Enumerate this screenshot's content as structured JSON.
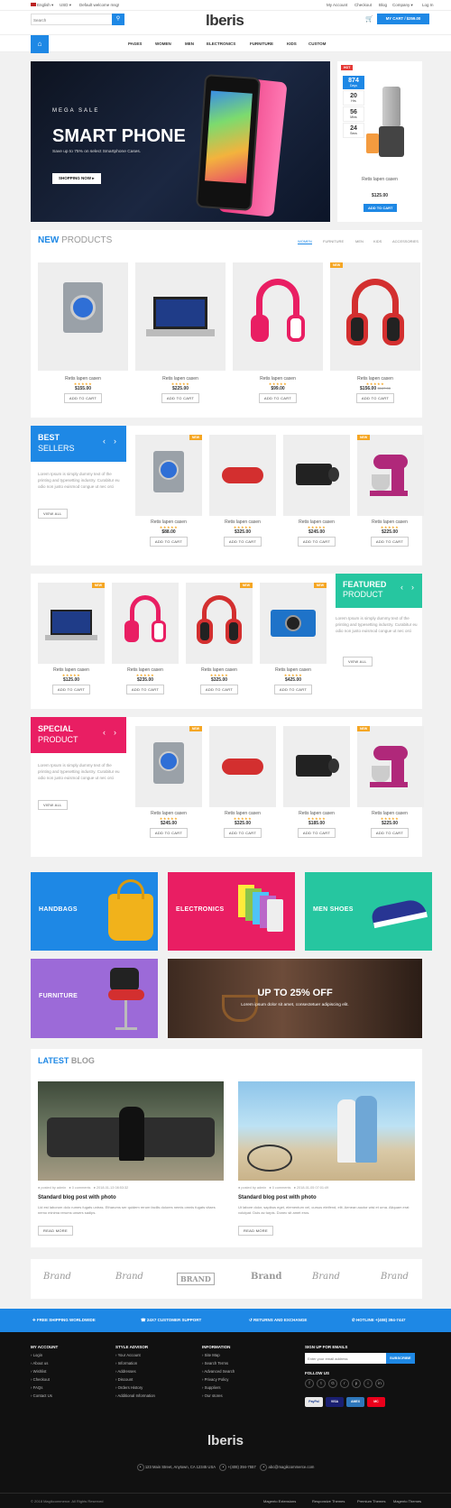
{
  "topbar": {
    "language": "English",
    "currency": "USD",
    "welcome": "Default welcome msg!",
    "links": [
      "My Account",
      "Checkout",
      "Blog",
      "Company",
      "Log In"
    ]
  },
  "header": {
    "search_placeholder": "Search",
    "logo": "lberis",
    "cart": "MY CART / $259.00"
  },
  "nav": {
    "items": [
      "PAGES",
      "WOMEN",
      "MEN",
      "ELECTRONICS",
      "FURNITURE",
      "KIDS",
      "CUSTOM"
    ]
  },
  "hero": {
    "kicker": "MEGA SALE",
    "title": "SMART PHONE",
    "subtitle": "Save up to 75% on select Smartphone Cases.",
    "cta": "SHOPPING NOW"
  },
  "deal": {
    "badge": "HOT",
    "countdown": [
      {
        "value": "874",
        "unit": "Days"
      },
      {
        "value": "20",
        "unit": "Hrs"
      },
      {
        "value": "56",
        "unit": "Mins"
      },
      {
        "value": "24",
        "unit": "Secs"
      }
    ],
    "name": "Retis lapen casen",
    "price": "$125.00",
    "cta": "ADD TO CART"
  },
  "new_products": {
    "title_a": "NEW",
    "title_b": "PRODUCTS",
    "tabs": [
      "WOMEN",
      "FURNITURE",
      "MEN",
      "KIDS",
      "ACCESSORIES"
    ],
    "items": [
      {
        "name": "Retis lapen casen",
        "price": "$155.00",
        "old": "",
        "cta": "ADD TO CART"
      },
      {
        "name": "Retis lapen casen",
        "price": "$225.00",
        "old": "",
        "cta": "ADD TO CART"
      },
      {
        "name": "Retis lapen casen",
        "price": "$99.00",
        "old": "",
        "cta": "ADD TO CART"
      },
      {
        "name": "Retis lapen casen",
        "price": "$156.00",
        "old": "$167.00",
        "cta": "ADD TO CART",
        "badge": "NEW"
      }
    ]
  },
  "best": {
    "title_a": "BEST",
    "title_b": "SELLERS",
    "text": "Lorem Ipsum is simply dummy text of the printing and typesetting industry. Curabitur eu odio non justo euismod congue ut nec orci",
    "cta": "VIEW ALL",
    "items": [
      {
        "name": "Retis lapen casen",
        "price": "$88.00",
        "cta": "ADD TO CART",
        "badge": "NEW"
      },
      {
        "name": "Retis lapen casen",
        "price": "$325.00",
        "cta": "ADD TO CART"
      },
      {
        "name": "Retis lapen casen",
        "price": "$245.00",
        "cta": "ADD TO CART"
      },
      {
        "name": "Retis lapen casen",
        "price": "$225.00",
        "cta": "ADD TO CART",
        "badge": "NEW"
      }
    ]
  },
  "featured": {
    "title_a": "FEATURED",
    "title_b": "PRODUCT",
    "text": "Lorem Ipsum is simply dummy text of the printing and typesetting industry. Curabitur eu odio non justo euismod congue ut nec orci",
    "cta": "VIEW ALL",
    "items": [
      {
        "name": "Retis lapen casen",
        "price": "$125.00",
        "cta": "ADD TO CART",
        "badge": "NEW"
      },
      {
        "name": "Retis lapen casen",
        "price": "$235.00",
        "cta": "ADD TO CART"
      },
      {
        "name": "Retis lapen casen",
        "price": "$325.00",
        "cta": "ADD TO CART",
        "badge": "NEW"
      },
      {
        "name": "Retis lapen casen",
        "price": "$425.00",
        "cta": "ADD TO CART",
        "badge": "NEW"
      }
    ]
  },
  "special": {
    "title_a": "SPECIAL",
    "title_b": "PRODUCT",
    "text": "Lorem Ipsum is simply dummy text of the printing and typesetting industry. Curabitur eu odio non justo euismod congue ut nec orci",
    "cta": "VIEW ALL",
    "items": [
      {
        "name": "Retis lapen casen",
        "price": "$245.00",
        "cta": "ADD TO CART",
        "badge": "NEW"
      },
      {
        "name": "Retis lapen casen",
        "price": "$325.00",
        "cta": "ADD TO CART"
      },
      {
        "name": "Retis lapen casen",
        "price": "$185.00",
        "cta": "ADD TO CART"
      },
      {
        "name": "Retis lapen casen",
        "price": "$225.00",
        "cta": "ADD TO CART",
        "badge": "NEW"
      }
    ]
  },
  "categories": {
    "handbags": "HANDBAGS",
    "electronics": "ELECTRONICS",
    "shoes": "MEN SHOES",
    "furniture": "FURNITURE",
    "sale_title": "UP TO 25% OFF",
    "sale_text": "Lorem ipsum dolor sit amet, consectetuer adipiscing elit."
  },
  "blog": {
    "title_a": "LATEST",
    "title_b": "BLOG",
    "posts": [
      {
        "author": "posted by admin",
        "comments": "0 comments",
        "date": "2018-01-13 08:53:32",
        "title": "Standard blog post with photo",
        "text": "Lid est laborum dolo rumes fugats untras. Etharums ser quidem rerum facilis dolores nemis omnis fugats vitaes nemo minima rerums unsers sadips.",
        "cta": "READ MORE"
      },
      {
        "author": "posted by admin",
        "comments": "0 comments",
        "date": "2018-01-05 07:01:49",
        "title": "Standard blog post with photo",
        "text": "Ut labore dolor, sapibus eget, elementum vel, cursus eleifend, elit. Aenean auctor wisi et urna. Aliquam erat volutpat. Duis ac turpis. Donec sit amet eros.",
        "cta": "READ MORE"
      }
    ]
  },
  "brands": [
    "Brand",
    "Brand",
    "BRAND",
    "Brand",
    "Brand",
    "Brand"
  ],
  "services": [
    "FREE SHIPPING WORLDWIDE",
    "24X7 CUSTOMER SUPPORT",
    "RETURNS AND EXCHANGE",
    "HOTLINE +(408) 394-7447"
  ],
  "footer": {
    "my_account": {
      "title": "MY ACCOUNT",
      "links": [
        "Login",
        "About us",
        "Wishlist",
        "Checkout",
        "FAQs",
        "Contact Us"
      ]
    },
    "style_advisor": {
      "title": "STYLE ADVISOR",
      "links": [
        "Your Account",
        "Information",
        "Addresses",
        "Discount",
        "Orders History",
        "Additional Information"
      ]
    },
    "information": {
      "title": "INFORMATION",
      "links": [
        "Site Map",
        "Search Terms",
        "Advanced Search",
        "Privacy Policy",
        "Suppliers",
        "Our stores"
      ]
    },
    "signup": {
      "title": "SIGN UP FOR EMAILS",
      "placeholder": "Enter your email address",
      "cta": "SUBSCRIBE",
      "follow": "FOLLOW US",
      "payments": [
        "PayPal",
        "VISA",
        "AMEX",
        "MC"
      ]
    },
    "logo": "lberis",
    "address": "123 Main Street, Anytown, CA 12345 USA",
    "phone": "+(408) 394-7557",
    "email": "abc@magikcommerce.com",
    "copyright": "© 2018 Magikcommerce. All Rights Reserved",
    "bottom_links": [
      "Magento Extensions",
      "Responsive Themes",
      "Premium Themes",
      "Magento Themes"
    ]
  },
  "colors": {
    "blue": "#1e88e5",
    "pink": "#e91e63",
    "teal": "#26c6a0",
    "purple": "#9c6ad8",
    "dark": "#111111"
  }
}
